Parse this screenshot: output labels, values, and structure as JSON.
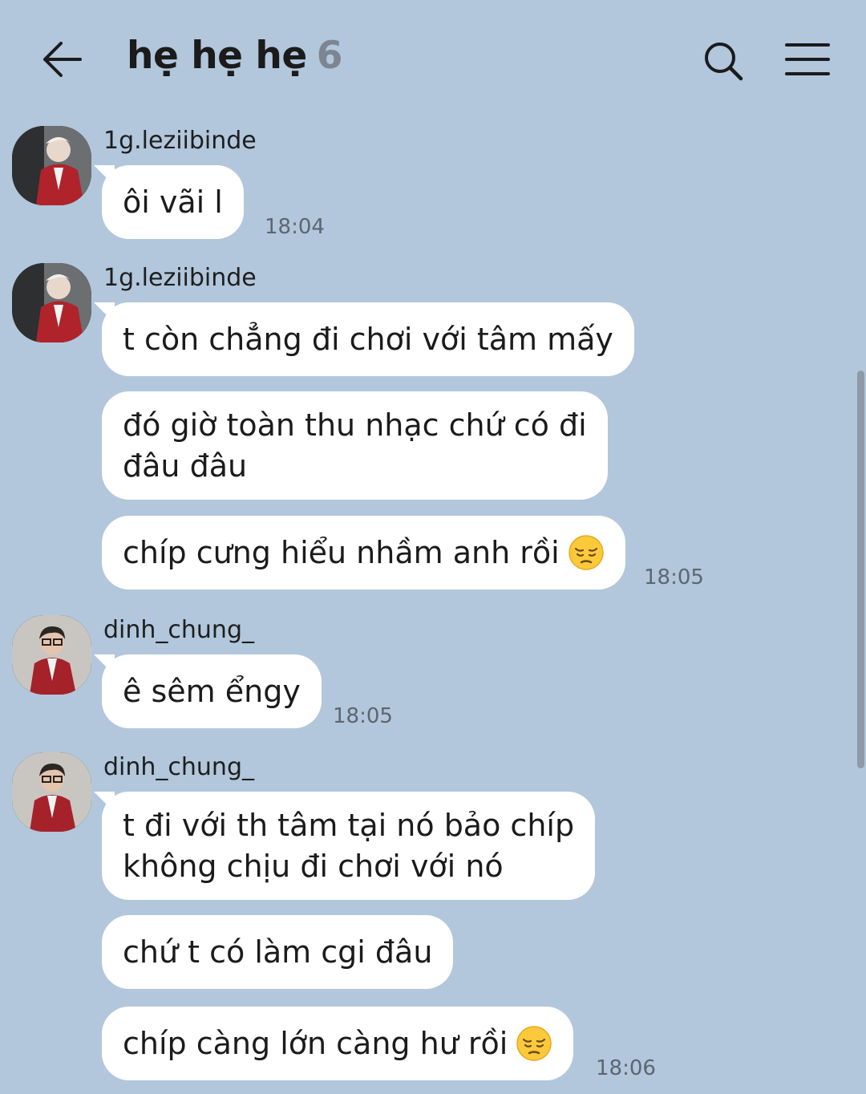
{
  "header": {
    "back_icon": "arrow-left-icon",
    "title": "hẹ hẹ hẹ",
    "member_count": "6",
    "search_icon": "search-icon",
    "menu_icon": "hamburger-menu-icon"
  },
  "colors": {
    "background": "#b2c7dc",
    "bubble": "#ffffff",
    "timestamp": "#5d6670",
    "member_count": "#7d8690"
  },
  "messages": [
    {
      "sender": "1g.leziibinde",
      "bubbles": [
        "ôi vãi l"
      ],
      "time": "18:04"
    },
    {
      "sender": "1g.leziibinde",
      "bubbles": [
        "t còn chẳng đi chơi với tâm mấy",
        "đó giờ toàn thu nhạc chứ có đi\nđâu đâu",
        "chíp cưng hiểu nhầm anh rồi"
      ],
      "time": "18:05"
    },
    {
      "sender": "dinh_chung_",
      "bubbles": [
        "ê sêm ểngy"
      ],
      "time": "18:05"
    },
    {
      "sender": "dinh_chung_",
      "bubbles": [
        "t đi với th tâm tại nó bảo chíp\nkhông chịu đi chơi với nó",
        "chứ t có làm cgi đâu",
        "chíp càng lớn càng hư rồi"
      ],
      "time": "18:06"
    }
  ],
  "emoji": "pensive-face-emoji"
}
